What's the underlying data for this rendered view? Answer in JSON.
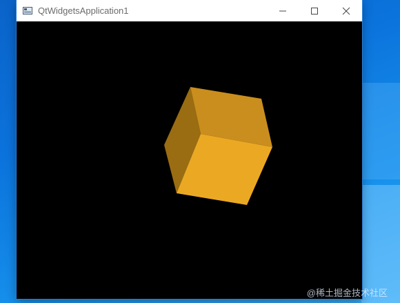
{
  "window": {
    "title": "QtWidgetsApplication1",
    "icon": "app-window-icon"
  },
  "titlebar_controls": {
    "minimize": "minimize-icon",
    "maximize": "maximize-icon",
    "close": "close-icon"
  },
  "scene": {
    "background": "#000000",
    "object": "cube",
    "faces": {
      "front": "#EBA923",
      "top": "#C98E1D",
      "left": "#9A6D12"
    }
  },
  "watermark": {
    "text": "@稀土掘金技术社区"
  }
}
